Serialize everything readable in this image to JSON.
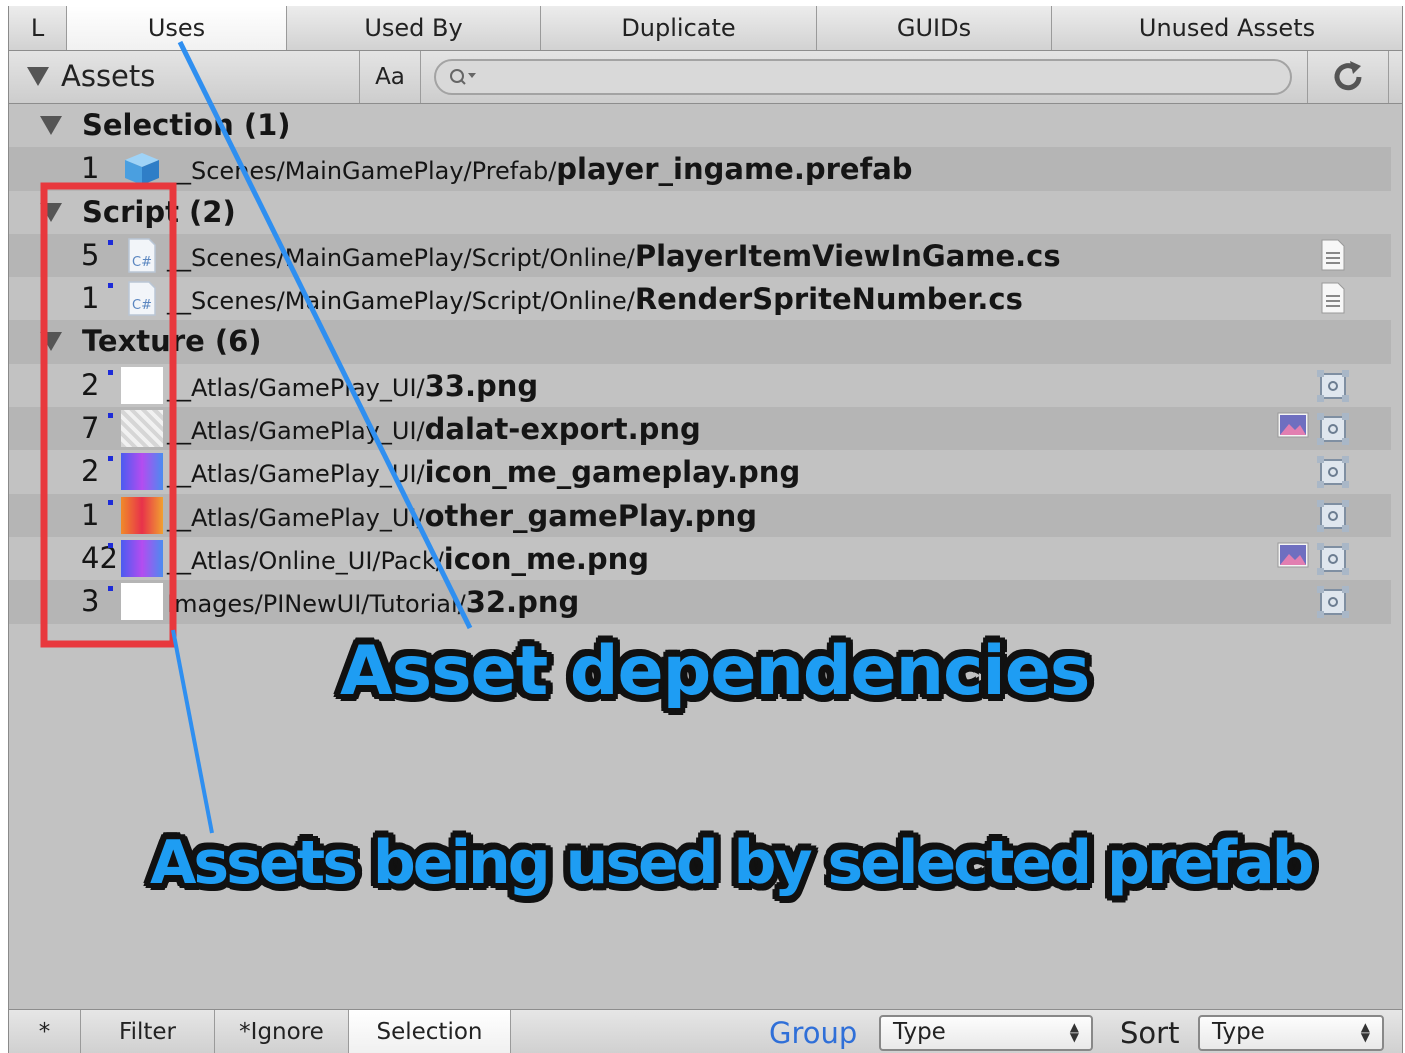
{
  "tabs": [
    {
      "label": "L",
      "active": false
    },
    {
      "label": "Uses",
      "active": true
    },
    {
      "label": "Used By",
      "active": false
    },
    {
      "label": "Duplicate",
      "active": false
    },
    {
      "label": "GUIDs",
      "active": false
    },
    {
      "label": "Unused Assets",
      "active": false
    }
  ],
  "toolbar": {
    "assets_label": "Assets",
    "case_button_label": "Aa",
    "search": {
      "value": "",
      "icon": "search-icon"
    },
    "refresh_icon": "refresh-icon"
  },
  "groups": {
    "selection": {
      "label": "Selection (1)",
      "items": [
        {
          "count": "1",
          "icon": "prefab-cube-icon",
          "path": "__Scenes/MainGamePlay/Prefab/",
          "file": "player_ingame.prefab"
        }
      ]
    },
    "script": {
      "label": "Script (2)",
      "items": [
        {
          "count": "5",
          "icon": "csharp-file-icon",
          "path": "__Scenes/MainGamePlay/Script/Online/",
          "file": "PlayerItemViewInGame.cs"
        },
        {
          "count": "1",
          "icon": "csharp-file-icon",
          "path": "__Scenes/MainGamePlay/Script/Online/",
          "file": "RenderSpriteNumber.cs"
        }
      ]
    },
    "texture": {
      "label": "Texture (6)",
      "items": [
        {
          "count": "2",
          "icon": "white-texture-thumb",
          "path": "__Atlas/GamePlay_UI/",
          "file": "33.png"
        },
        {
          "count": "7",
          "icon": "grey-texture-thumb",
          "path": "__Atlas/GamePlay_UI/",
          "file": "dalat-export.png"
        },
        {
          "count": "2",
          "icon": "blue-icon-thumb",
          "path": "__Atlas/GamePlay_UI/",
          "file": "icon_me_gameplay.png"
        },
        {
          "count": "1",
          "icon": "red-icon-thumb",
          "path": "__Atlas/GamePlay_UI/",
          "file": "other_gamePlay.png"
        },
        {
          "count": "42",
          "icon": "blue-icon-thumb",
          "path": "__Atlas/Online_UI/Pack/",
          "file": "icon_me.png"
        },
        {
          "count": "3",
          "icon": "white-texture-thumb",
          "path": "Images/PINewUI/Tutorial/",
          "file": "32.png"
        }
      ]
    }
  },
  "bottom": {
    "star_label": "*",
    "filter_label": "Filter",
    "ignore_label": "*Ignore",
    "selection_label": "Selection",
    "group_label": "Group",
    "group_value": "Type",
    "sort_label": "Sort",
    "sort_value": "Type"
  },
  "annotations": {
    "callout_1": "Asset dependencies",
    "callout_2": "Assets being used by selected prefab",
    "arrow_color": "#2f8ff0",
    "box_color": "#e8383d"
  }
}
